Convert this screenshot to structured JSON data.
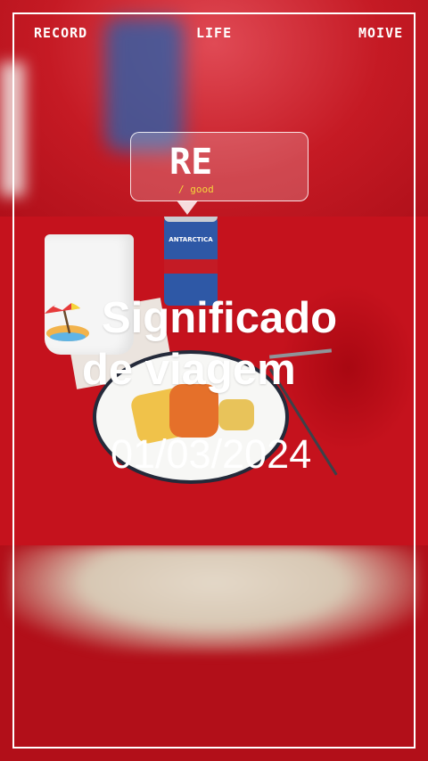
{
  "topbar": {
    "left": "RECORD",
    "center": "LIFE",
    "right": "MOIVE"
  },
  "bubble": {
    "title": "RE",
    "subtitle": "/ good"
  },
  "headline": {
    "line1": "Significado",
    "line2": "de viagem"
  },
  "date": "01/03/2024",
  "photo": {
    "can_text": "ANTARCTICA"
  },
  "icons": {
    "headline_emoji": "beach-umbrella-icon"
  },
  "colors": {
    "background": "#c0121b",
    "frame": "#ffffff",
    "subtitle": "#f5d43a"
  }
}
